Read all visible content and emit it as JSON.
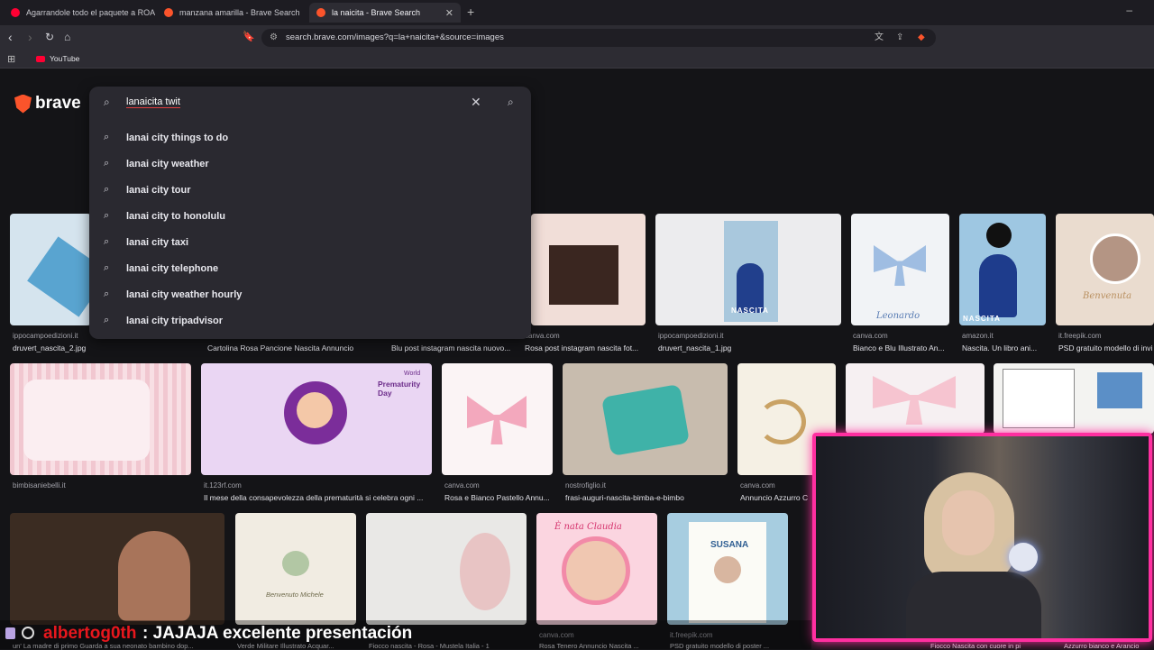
{
  "browser": {
    "tabs": [
      {
        "title": "Agarrandole todo el paquete a ROA",
        "favicon_color": "#ff0033"
      },
      {
        "title": "manzana amarilla - Brave Search",
        "favicon_color": "#fb542b"
      },
      {
        "title": "la naicita - Brave Search",
        "favicon_color": "#fb542b",
        "active": true
      }
    ],
    "new_tab_icon": "+",
    "minimize_icon": "–",
    "url": "search.brave.com/images?q=la+naicita+&source=images",
    "bookmarks": [
      {
        "label": "YouTube"
      }
    ]
  },
  "brand": {
    "name": "brave",
    "accent": "#fb542b"
  },
  "search": {
    "query": "lanaicita twit",
    "suggestions": [
      "lanai city things to do",
      "lanai city weather",
      "lanai city tour",
      "lanai city to honolulu",
      "lanai city taxi",
      "lanai city telephone",
      "lanai city weather hourly",
      "lanai city tripadvisor"
    ]
  },
  "results": {
    "row1": [
      {
        "source": "ippocampoedizioni.it",
        "title": "druvert_nascita_2.jpg"
      },
      {
        "source": "",
        "title": "Cartolina Rosa Pancione Nascita Annuncio"
      },
      {
        "source": "",
        "title": "Blu post instagram nascita nuovo..."
      },
      {
        "source": "canva.com",
        "title": "Rosa post instagram nascita fot..."
      },
      {
        "source": "ippocampoedizioni.it",
        "title": "druvert_nascita_1.jpg"
      },
      {
        "source": "canva.com",
        "title": "Bianco e Blu Illustrato An..."
      },
      {
        "source": "amazon.it",
        "title": "Nascita. Un libro ani..."
      },
      {
        "source": "it.freepik.com",
        "title": "PSD gratuito modello di invi"
      }
    ],
    "row2": [
      {
        "source": "bimbisaniebelli.it",
        "title": ""
      },
      {
        "source": "it.123rf.com",
        "title": "Il mese della consapevolezza della prematurità si celebra ogni ..."
      },
      {
        "source": "canva.com",
        "title": "Rosa e Bianco Pastello Annu..."
      },
      {
        "source": "nostrofiglio.it",
        "title": "frasi-auguri-nascita-bimba-e-bimbo"
      },
      {
        "source": "canva.com",
        "title": "Annuncio Azzurro C"
      }
    ],
    "row3": [
      {
        "source": "",
        "title": "un' La madre di primo Guarda a sua neonato bambino dop..."
      },
      {
        "source": "",
        "title": "Verde Militare Illustrato Acquar..."
      },
      {
        "source": "",
        "title": "Fiocco nascita - Rosa - Mustela Italia - 1"
      },
      {
        "source": "canva.com",
        "title": "Rosa Tenero Annuncio Nascita ..."
      },
      {
        "source": "it.freepik.com",
        "title": "PSD gratuito modello di poster ..."
      },
      {
        "source": "",
        "title": "Fiocco Nascita con cuore in pie..."
      },
      {
        "source": "",
        "title": "Azzurro bianco e Arancio"
      }
    ],
    "image_text": {
      "premature": "Prematurity Day",
      "premature_small": "World",
      "nascita": "NASCITA",
      "nascita2": "NASCITA",
      "leonardo": "Leonardo",
      "benvenuta": "Benvenuta",
      "susana": "SUSANA",
      "claudia": "È nata Claudia",
      "benvenuto": "Benvenuto Michele"
    }
  },
  "stream_chat": {
    "user": "albertog0th",
    "message": ": JAJAJA excelente presentación"
  }
}
